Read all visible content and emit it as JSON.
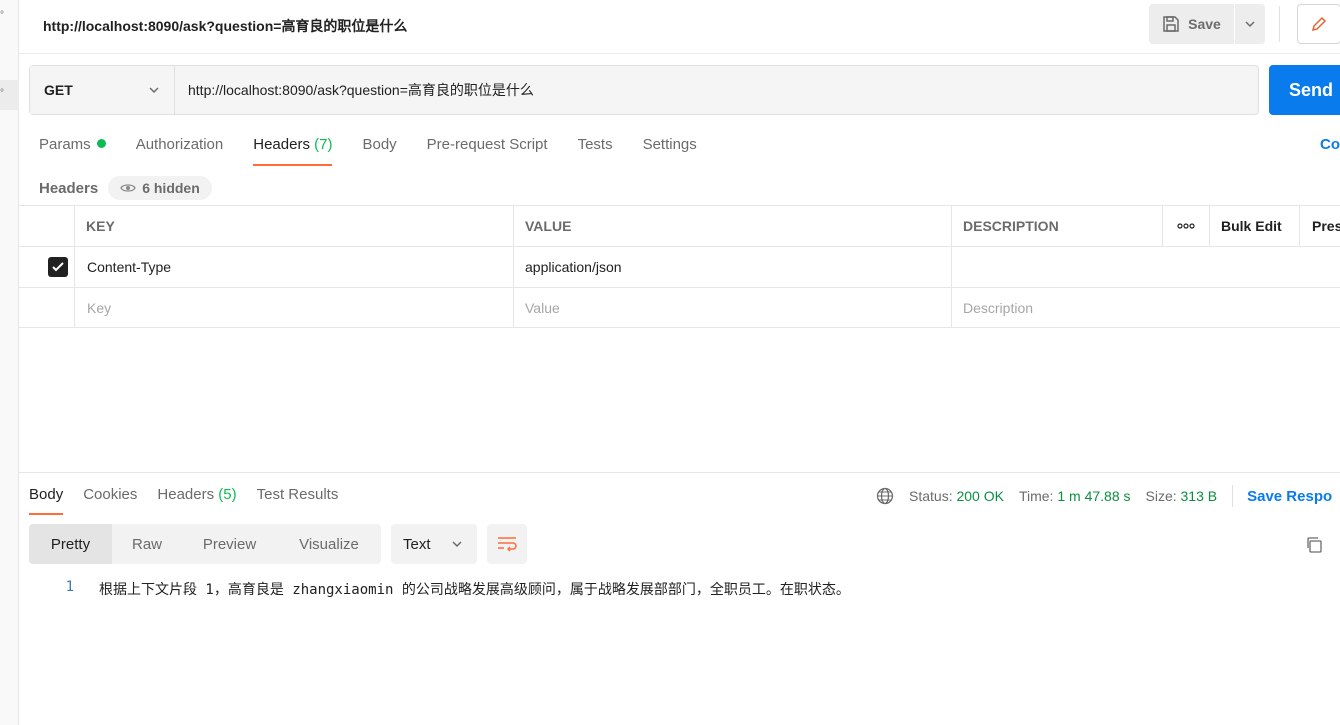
{
  "window": {
    "title": "http://localhost:8090/ask?question=高育良的职位是什么",
    "save_label": "Save"
  },
  "request": {
    "method": "GET",
    "url": "http://localhost:8090/ask?question=高育良的职位是什么",
    "send_label": "Send",
    "tabs": [
      {
        "label": "Params"
      },
      {
        "label": "Authorization"
      },
      {
        "label": "Headers",
        "count": "(7)"
      },
      {
        "label": "Body"
      },
      {
        "label": "Pre-request Script"
      },
      {
        "label": "Tests"
      },
      {
        "label": "Settings"
      }
    ],
    "cookies_link": "Co",
    "headers_sub_label": "Headers",
    "hidden_count": "6 hidden"
  },
  "headers_table": {
    "columns": [
      "KEY",
      "VALUE",
      "DESCRIPTION"
    ],
    "bulk_edit": "Bulk Edit",
    "presets": "Pres",
    "rows": [
      {
        "key": "Content-Type",
        "value": "application/json",
        "description": ""
      }
    ],
    "placeholders": {
      "key": "Key",
      "value": "Value",
      "description": "Description"
    }
  },
  "response": {
    "tabs": [
      {
        "label": "Body"
      },
      {
        "label": "Cookies"
      },
      {
        "label": "Headers",
        "count": "(5)"
      },
      {
        "label": "Test Results"
      }
    ],
    "status_label": "Status:",
    "status_value": "200 OK",
    "time_label": "Time:",
    "time_value": "1 m 47.88 s",
    "size_label": "Size:",
    "size_value": "313 B",
    "save_response": "Save Respo",
    "view_tabs": [
      "Pretty",
      "Raw",
      "Preview",
      "Visualize"
    ],
    "format": "Text",
    "lines": [
      {
        "no": "1",
        "text": "根据上下文片段 1，高育良是 zhangxiaomin 的公司战略发展高级顾问，属于战略发展部部门，全职员工。在职状态。"
      }
    ]
  },
  "colors": {
    "accent_orange": "#ff6c37",
    "send_blue": "#097bed",
    "status_green": "#0a8f3f"
  }
}
